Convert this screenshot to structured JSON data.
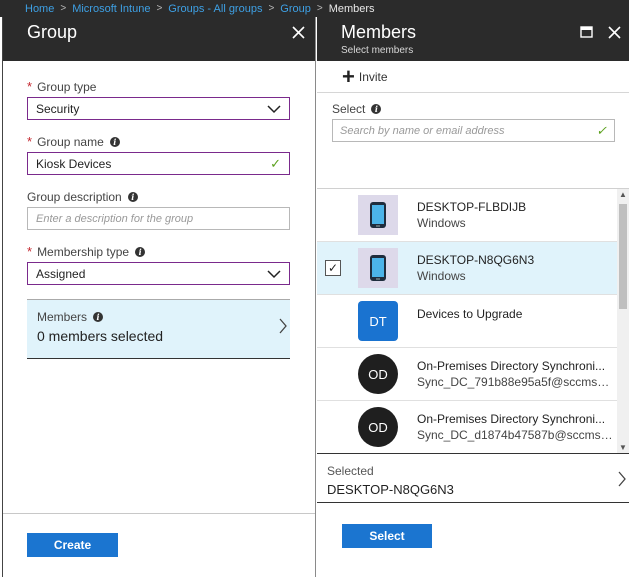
{
  "breadcrumb": [
    "Home",
    "Microsoft Intune",
    "Groups - All groups",
    "Group",
    "Members"
  ],
  "group_panel": {
    "title": "Group",
    "group_type": {
      "label": "Group type",
      "value": "Security"
    },
    "group_name": {
      "label": "Group name",
      "value": "Kiosk Devices"
    },
    "group_description": {
      "label": "Group description",
      "placeholder": "Enter a description for the group"
    },
    "membership_type": {
      "label": "Membership type",
      "value": "Assigned"
    },
    "members": {
      "label": "Members",
      "count_text": "0 members selected"
    },
    "create_label": "Create"
  },
  "members_panel": {
    "title": "Members",
    "subtitle": "Select members",
    "invite_label": "Invite",
    "select_label": "Select",
    "search_placeholder": "Search by name or email address",
    "items": [
      {
        "name": "DESKTOP-FLBDIJB",
        "sub": "Windows",
        "avatar": "phone-icon",
        "selected": false
      },
      {
        "name": "DESKTOP-N8QG6N3",
        "sub": "Windows",
        "avatar": "phone-icon",
        "selected": true
      },
      {
        "name": "Devices to Upgrade",
        "sub": "",
        "avatar": "DT",
        "selected": false
      },
      {
        "name": "On-Premises Directory Synchroni...",
        "sub": "Sync_DC_791b88e95a5f@sccmsol...",
        "avatar": "OD",
        "selected": false
      },
      {
        "name": "On-Premises Directory Synchroni...",
        "sub": "Sync_DC_d1874b47587b@sccmsol...",
        "avatar": "OD",
        "selected": false
      }
    ],
    "selected_label": "Selected",
    "selected_value": "DESKTOP-N8QG6N3",
    "select_button_label": "Select"
  },
  "colors": {
    "accent": "#1b75d0",
    "header": "#2b2b2b",
    "selected_bg": "#e0f3fb",
    "required": "#c4262e",
    "focus_border": "#7a2a8c"
  }
}
